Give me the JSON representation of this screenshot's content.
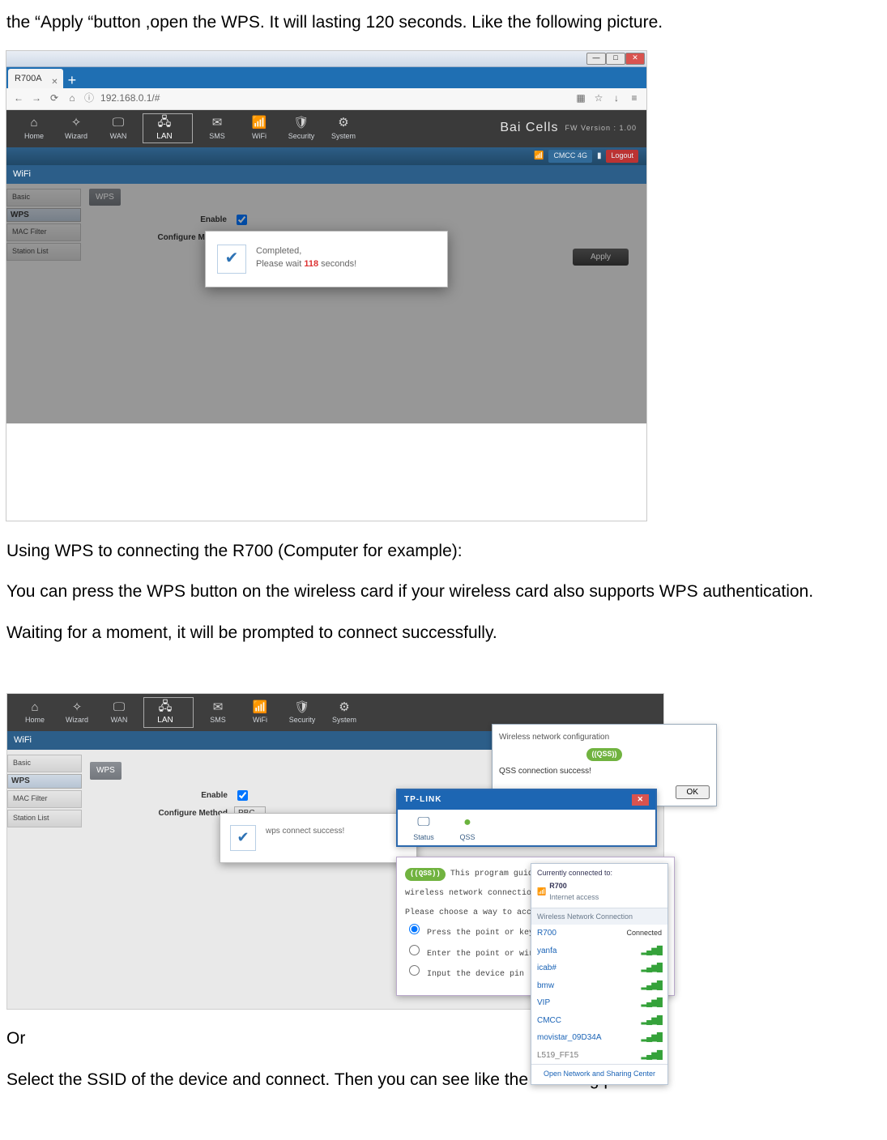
{
  "doc": {
    "p1": "the   “Apply   “button ,open the WPS. It will lasting 120 seconds. Like the following picture.",
    "p2": "Using WPS to connecting the R700 (Computer for example):",
    "p3": "You can press the WPS button on the wireless card if your wireless card also supports WPS authentication.",
    "p4": "Waiting for a moment, it will be prompted to connect successfully.",
    "p5": "Or",
    "p6": "Select the SSID of the device and connect. Then you can see like the following picture."
  },
  "s1": {
    "tab": "R700A",
    "url": "192.168.0.1/#",
    "nav": [
      "Home",
      "Wizard",
      "WAN",
      "LAN",
      "SMS",
      "WiFi",
      "Security",
      "System"
    ],
    "brand": "Bai Cells",
    "fw": "FW Version : 1.00",
    "section": "WiFi",
    "statuschip": "CMCC  4G",
    "logout": "Logout",
    "side": [
      "Basic",
      "WPS",
      "MAC Filter",
      "Station List"
    ],
    "side_sel": 1,
    "panel_title": "WPS",
    "lbl_enable": "Enable",
    "lbl_method": "Configure Method",
    "method_val": "PBC",
    "apply": "Apply",
    "dlg_l1": "Completed,",
    "dlg_l2a": "Please wait",
    "dlg_l2b": "118",
    "dlg_l2c": "seconds!"
  },
  "s2": {
    "dlg_msg": "wps connect success!",
    "tplink_brand": "TP-LINK",
    "tplink_items": [
      "Status",
      "QSS"
    ],
    "qss_title": "Wireless network configuration",
    "qss_name": "QSS",
    "qss_msg": "QSS connection success!",
    "qss_ok": "OK",
    "guide_l1": "This program guides you to",
    "guide_l2": "wireless network connectio",
    "guide_l3": "Please choose a way to access the net",
    "guide_o1": "Press the point or key of wireless",
    "guide_o2": "Enter the point or wireless router",
    "guide_o3": "Input the device pin",
    "wl_hd1": "Currently connected to:",
    "wl_hd2": "R700",
    "wl_hd3": "Internet access",
    "wl_sec": "Wireless Network Connection",
    "wl_connected": "Connected",
    "wl_nets": [
      "R700",
      "yanfa",
      "icab#",
      "bmw",
      "VIP",
      "CMCC",
      "movistar_09D34A",
      "L519_FF15"
    ],
    "wl_ft": "Open Network and Sharing Center"
  }
}
